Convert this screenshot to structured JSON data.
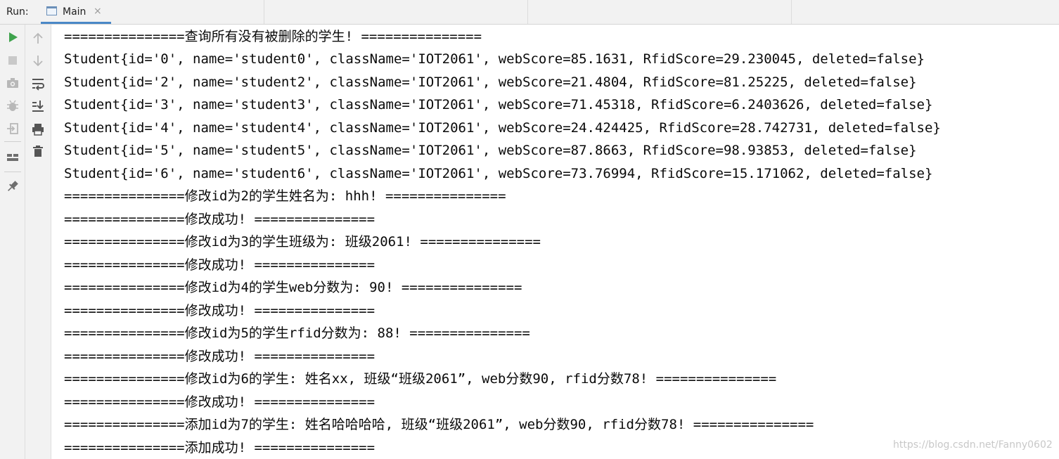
{
  "run_panel": {
    "label": "Run:",
    "tab": {
      "label": "Main",
      "close_symbol": "×"
    }
  },
  "toolbar_left": [
    {
      "name": "run-icon",
      "color": "#3fa34d"
    },
    {
      "name": "stop-icon",
      "color": "#c9c9c9"
    },
    {
      "name": "camera-icon",
      "color": "#b8b8b8"
    },
    {
      "name": "debug-icon",
      "color": "#b8b8b8"
    },
    {
      "name": "exit-icon",
      "color": "#b8b8b8"
    },
    {
      "name": "layout-icon",
      "color": "#6e6e6e"
    },
    {
      "name": "pin-icon",
      "color": "#6e6e6e"
    }
  ],
  "toolbar_right": [
    {
      "name": "arrow-up-icon",
      "color": "#b8b8b8"
    },
    {
      "name": "arrow-down-icon",
      "color": "#b8b8b8"
    },
    {
      "name": "soft-wrap-icon",
      "color": "#555555"
    },
    {
      "name": "scroll-to-end-icon",
      "color": "#555555"
    },
    {
      "name": "print-icon",
      "color": "#555555"
    },
    {
      "name": "trash-icon",
      "color": "#555555"
    }
  ],
  "console": {
    "lines": [
      "===============查询所有没有被删除的学生! ===============",
      "Student{id='0', name='student0', className='IOT2061', webScore=85.1631, RfidScore=29.230045, deleted=false}",
      "Student{id='2', name='student2', className='IOT2061', webScore=21.4804, RfidScore=81.25225, deleted=false}",
      "Student{id='3', name='student3', className='IOT2061', webScore=71.45318, RfidScore=6.2403626, deleted=false}",
      "Student{id='4', name='student4', className='IOT2061', webScore=24.424425, RfidScore=28.742731, deleted=false}",
      "Student{id='5', name='student5', className='IOT2061', webScore=87.8663, RfidScore=98.93853, deleted=false}",
      "Student{id='6', name='student6', className='IOT2061', webScore=73.76994, RfidScore=15.171062, deleted=false}",
      "===============修改id为2的学生姓名为: hhh! ===============",
      "===============修改成功! ===============",
      "===============修改id为3的学生班级为: 班级2061! ===============",
      "===============修改成功! ===============",
      "===============修改id为4的学生web分数为: 90! ===============",
      "===============修改成功! ===============",
      "===============修改id为5的学生rfid分数为: 88! ===============",
      "===============修改成功! ===============",
      "===============修改id为6的学生: 姓名xx, 班级“班级2061”, web分数90, rfid分数78! ===============",
      "===============修改成功! ===============",
      "===============添加id为7的学生: 姓名哈哈哈哈, 班级“班级2061”, web分数90, rfid分数78! ===============",
      "===============添加成功! ==============="
    ]
  },
  "watermark": "https://blog.csdn.net/Fanny0602"
}
